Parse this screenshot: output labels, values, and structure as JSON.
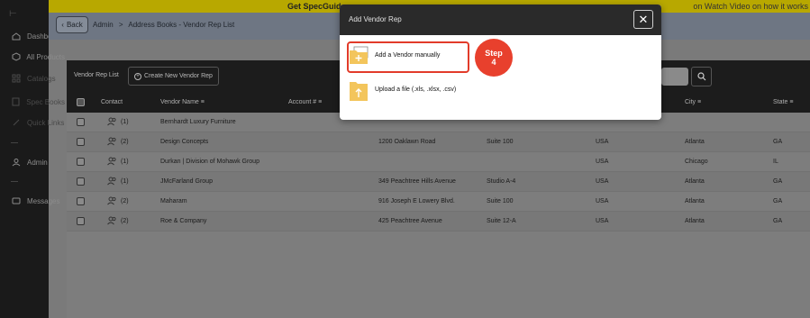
{
  "banner": {
    "text": "Get SpecGuide",
    "right_text": "on Watch Video on how it works"
  },
  "sidebar": {
    "items": [
      {
        "label": "Dashboard",
        "icon": "home-icon"
      },
      {
        "label": "All Products",
        "icon": "cube-icon"
      },
      {
        "label": "Catalogs",
        "icon": "grid-icon"
      },
      {
        "label": "Spec Books",
        "icon": "document-icon"
      },
      {
        "label": "Quick Links",
        "icon": "link-icon"
      },
      {
        "label": "Admin",
        "icon": "user-icon"
      },
      {
        "label": "Messages",
        "icon": "message-icon"
      }
    ]
  },
  "header": {
    "back_label": "Back",
    "breadcrumb": [
      "Admin",
      ">",
      "Address Books - Vendor Rep List"
    ]
  },
  "toolbar": {
    "tab_label": "Vendor Rep List",
    "create_label": "Create New Vendor Rep"
  },
  "table": {
    "columns": [
      "Contact",
      "Vendor Name",
      "Account #",
      "City",
      "State"
    ],
    "sort_glyph": "≡",
    "rows": [
      {
        "contacts": "(1)",
        "vendor": "Bernhardt Luxury Furniture",
        "address": "",
        "suite": "",
        "country": "",
        "city": "",
        "state": ""
      },
      {
        "contacts": "(2)",
        "vendor": "Design Concepts",
        "address": "1200 Oaklawn Road",
        "suite": "Suite 100",
        "country": "USA",
        "city": "Atlanta",
        "state": "GA"
      },
      {
        "contacts": "(1)",
        "vendor": "Durkan | Division of Mohawk Group",
        "address": "",
        "suite": "",
        "country": "USA",
        "city": "Chicago",
        "state": "IL"
      },
      {
        "contacts": "(1)",
        "vendor": "JMcFarland Group",
        "address": "349 Peachtree Hills Avenue",
        "suite": "Studio A-4",
        "country": "USA",
        "city": "Atlanta",
        "state": "GA"
      },
      {
        "contacts": "(2)",
        "vendor": "Maharam",
        "address": "916 Joseph E Lowery Blvd.",
        "suite": "Suite 100",
        "country": "USA",
        "city": "Atlanta",
        "state": "GA"
      },
      {
        "contacts": "(2)",
        "vendor": "Roe & Company",
        "address": "425 Peachtree Avenue",
        "suite": "Suite 12-A",
        "country": "USA",
        "city": "Atlanta",
        "state": "GA"
      }
    ]
  },
  "modal": {
    "title": "Add Vendor Rep",
    "close_glyph": "✕",
    "option_manual": "Add a Vendor manually",
    "option_upload": "Upload a file (.xls, .xlsx, .csv)"
  },
  "step_badge": {
    "line1": "Step",
    "line2": "4"
  },
  "colors": {
    "accent_red": "#e8402d",
    "folder_yellow": "#f3c55c"
  }
}
